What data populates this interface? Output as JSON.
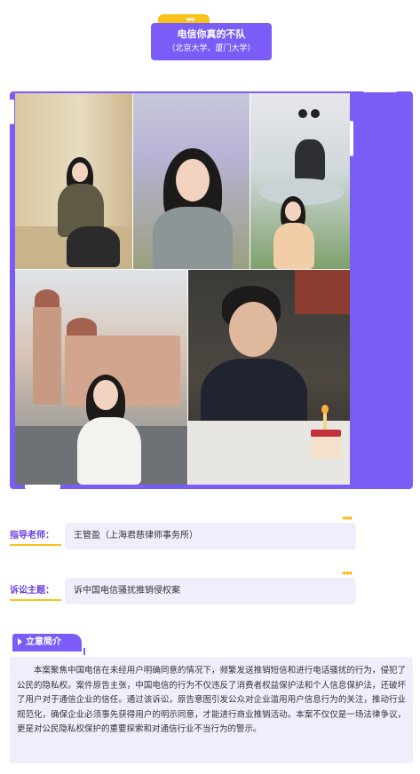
{
  "team": {
    "name": "电信你真的不队",
    "schools": "（北京大学、厦门大学）"
  },
  "info": {
    "advisor_label": "指导老师：",
    "advisor_value": "王管盈（上海君慈律师事务所）",
    "topic_label": "诉讼主题：",
    "topic_value": "诉中国电信骚扰推销侵权案"
  },
  "intro": {
    "heading": "立意简介",
    "body": "本案聚焦中国电信在未经用户明确同意的情况下，频繁发送推销短信和进行电话骚扰的行为，侵犯了公民的隐私权。案件原告主张，中国电信的行为不仅违反了消费者权益保护法和个人信息保护法，还破坏了用户对于通信企业的信任。通过该诉讼，原告意图引发公众对企业滥用用户信息行为的关注，推动行业规范化，确保企业必须事先获得用户的明示同意，才能进行商业推销活动。本案不仅仅是一场法律争议，更是对公民隐私权保护的重要探索和对通信行业不当行为的警示。"
  },
  "decor": {
    "arrows": "◂◂◂",
    "title_arrows": "▸▸▸"
  },
  "colors": {
    "accent": "#7b5cf6",
    "highlight": "#f7c31c",
    "label": "#6a3fe0",
    "panel": "#f1eefc"
  }
}
